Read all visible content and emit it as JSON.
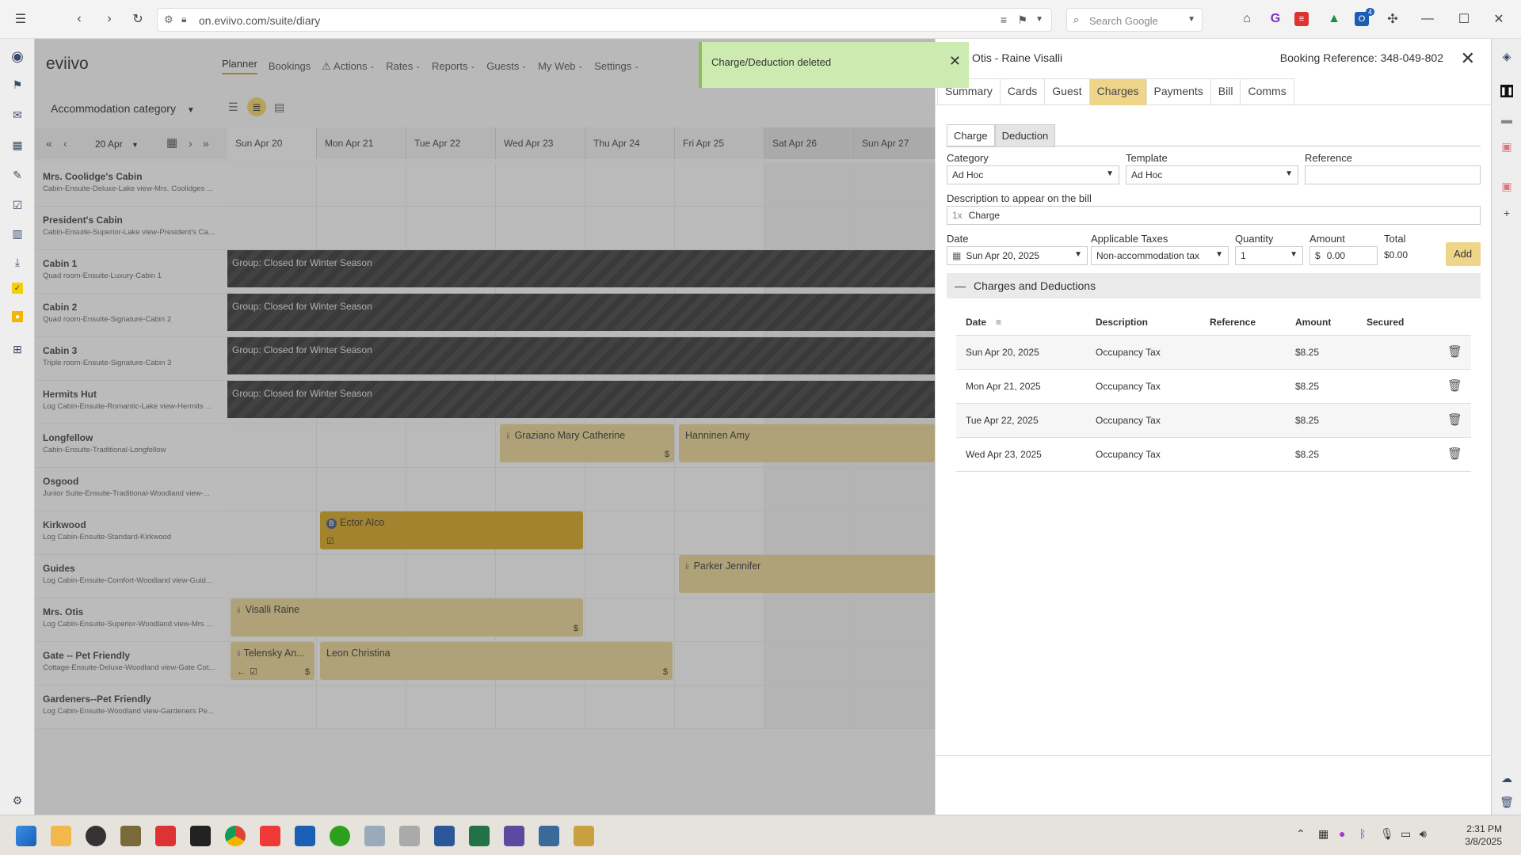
{
  "browser": {
    "url": "on.eviivo.com/suite/diary",
    "search_placeholder": "Search Google",
    "badge_count": "4"
  },
  "app": {
    "logo": "eviivo",
    "nav": [
      {
        "label": "Planner",
        "active": true
      },
      {
        "label": "Bookings"
      },
      {
        "label": "Actions",
        "dropdown": true
      },
      {
        "label": "Rates",
        "dropdown": true
      },
      {
        "label": "Reports",
        "dropdown": true
      },
      {
        "label": "Guests",
        "dropdown": true
      },
      {
        "label": "My Web",
        "dropdown": true
      },
      {
        "label": "Settings",
        "dropdown": true
      }
    ],
    "accommodation_select": "Accommodation category",
    "date_select": "20 Apr",
    "days": [
      "Sun Apr 20",
      "Mon Apr 21",
      "Tue Apr 22",
      "Wed Apr 23",
      "Thu Apr 24",
      "Fri Apr 25",
      "Sat Apr 26",
      "Sun Apr 27"
    ],
    "rooms": [
      {
        "name": "Mrs. Coolidge's Cabin",
        "sub": "Cabin-Ensuite-Deluxe-Lake view-Mrs. Coolidges ..."
      },
      {
        "name": "President's Cabin",
        "sub": "Cabin-Ensuite-Superior-Lake view-President's Ca..."
      },
      {
        "name": "Cabin 1",
        "sub": "Quad room-Ensuite-Luxury-Cabin 1"
      },
      {
        "name": "Cabin 2",
        "sub": "Quad room-Ensuite-Signature-Cabin 2"
      },
      {
        "name": "Cabin 3",
        "sub": "Triple room-Ensuite-Signature-Cabin 3"
      },
      {
        "name": "Hermits Hut",
        "sub": "Log Cabin-Ensuite-Romantic-Lake view-Hermits ..."
      },
      {
        "name": "Longfellow",
        "sub": "Cabin-Ensuite-Traditional-Longfellow"
      },
      {
        "name": "Osgood",
        "sub": "Junior Suite-Ensuite-Traditional-Woodland view-..."
      },
      {
        "name": "Kirkwood",
        "sub": "Log Cabin-Ensuite-Standard-Kirkwood"
      },
      {
        "name": "Guides",
        "sub": "Log Cabin-Ensuite-Comfort-Woodland view-Guid..."
      },
      {
        "name": "Mrs. Otis",
        "sub": "Log Cabin-Ensuite-Superior-Woodland view-Mrs ..."
      },
      {
        "name": "Gate -- Pet Friendly",
        "sub": "Cottage-Ensuite-Deluxe-Woodland view-Gate Cot..."
      },
      {
        "name": "Gardeners--Pet Friendly",
        "sub": "Log Cabin-Ensuite-Woodland view-Gardeners Pe..."
      }
    ],
    "closed_label": "Group: Closed for Winter Season",
    "bookings": {
      "graziano": "Graziano Mary Catherine",
      "hanninen": "Hanninen Amy",
      "ector": "Ector Alco",
      "parker": "Parker Jennifer",
      "visalli": "Visalli Raine",
      "telensky": "Telensky An...",
      "leon": "Leon Christina",
      "dollar": "$"
    }
  },
  "toast": {
    "message": "Charge/Deduction deleted"
  },
  "panel": {
    "title": "Otis - Raine Visalli",
    "booking_ref": "Booking Reference: 348-049-802",
    "tabs": [
      "Summary",
      "Cards",
      "Guest",
      "Charges",
      "Payments",
      "Bill",
      "Comms"
    ],
    "active_tab": "Charges",
    "subtabs": [
      "Charge",
      "Deduction"
    ],
    "form": {
      "category_label": "Category",
      "category_value": "Ad Hoc",
      "template_label": "Template",
      "template_value": "Ad Hoc",
      "reference_label": "Reference",
      "description_label": "Description to appear on the bill",
      "description_prefix": "1x",
      "description_value": "Charge",
      "date_label": "Date",
      "date_value": "Sun Apr 20, 2025",
      "taxes_label": "Applicable Taxes",
      "taxes_value": "Non-accommodation tax",
      "quantity_label": "Quantity",
      "quantity_value": "1",
      "amount_label": "Amount",
      "amount_currency": "$",
      "amount_value": "0.00",
      "total_label": "Total",
      "total_value": "$0.00",
      "add_label": "Add"
    },
    "section_title": "Charges and Deductions",
    "table": {
      "headers": [
        "Date",
        "Description",
        "Reference",
        "Amount",
        "Secured"
      ],
      "rows": [
        {
          "date": "Sun Apr 20, 2025",
          "description": "Occupancy Tax",
          "reference": "",
          "amount": "$8.25"
        },
        {
          "date": "Mon Apr 21, 2025",
          "description": "Occupancy Tax",
          "reference": "",
          "amount": "$8.25"
        },
        {
          "date": "Tue Apr 22, 2025",
          "description": "Occupancy Tax",
          "reference": "",
          "amount": "$8.25"
        },
        {
          "date": "Wed Apr 23, 2025",
          "description": "Occupancy Tax",
          "reference": "",
          "amount": "$8.25"
        }
      ]
    }
  },
  "taskbar": {
    "time": "2:31 PM",
    "date": "3/8/2025"
  }
}
